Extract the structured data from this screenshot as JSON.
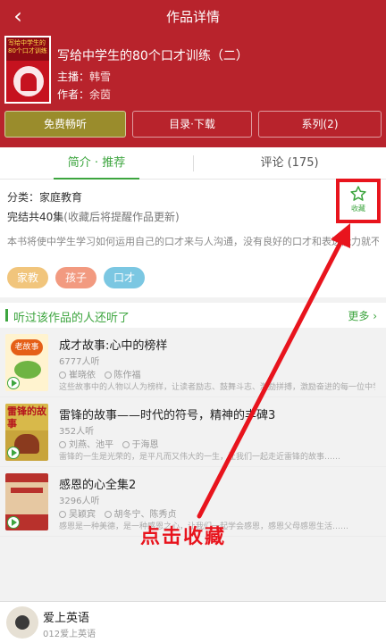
{
  "header": {
    "title": "作品详情",
    "back_icon": "‹",
    "book_title": "写给中学生的80个口才训练（二）",
    "host_label": "主播：",
    "host_value": "韩雪",
    "author_label": "作者：",
    "author_value": "余茵",
    "cover_text": "写给中学生的80个口才训练",
    "buttons": {
      "free_listen": "免费畅听",
      "catalog_download": "目录·下载",
      "series": "系列(2)"
    }
  },
  "tabs": {
    "intro": "简介 · 推荐",
    "comments": "评论 (175)"
  },
  "intro": {
    "category_label": "分类：",
    "category_value": "家庭教育",
    "episodes": "完结共40集",
    "episodes_note": "(收藏后将提醒作品更新)",
    "description": "本书将使中学生学习如何运用自己的口才来与人沟通，没有良好的口才和表达能力就不能将自己的优势展现。好口才的秘密就在书里！学习交友必不可少的指导伙伴",
    "tags": [
      "家教",
      "孩子",
      "口才"
    ],
    "favorite_label": "收藏"
  },
  "related": {
    "title": "听过该作品的人还听了",
    "more": "更多 ›",
    "items": [
      {
        "name": "成才故事:心中的榜样",
        "listeners": "6777人听",
        "people1": "崔晓依",
        "people2": "陈作福",
        "desc": "这些故事中的人物以人为榜样，让读者励志、鼓舞斗志、激励拼搏，激励奋进的每一位中学生不断努力奋斗……",
        "thumb_badge": "老故事"
      },
      {
        "name": "雷锋的故事——时代的符号，精神的丰碑3",
        "listeners": "352人听",
        "people1": "刘燕、池平",
        "people2": "于海恩",
        "desc": "雷锋的一生是光荣的，是平凡而又伟大的一生，让我们一起走近雷锋的故事……",
        "thumb_badge": "雷锋的故事"
      },
      {
        "name": "感恩的心全集2",
        "listeners": "3296人听",
        "people1": "吴颖宾",
        "people2": "胡冬宁、陈秀贞",
        "desc": "感恩是一种美德，是一种感恩之心，让我们一起学会感恩，感恩父母感恩生活……",
        "thumb_badge": ""
      }
    ]
  },
  "annotation": {
    "text": "点击收藏",
    "color": "#e8141d"
  },
  "player": {
    "title": "爱上英语",
    "subtitle": "012爱上英语"
  },
  "colors": {
    "header_red": "#b8232c",
    "accent_green": "#3da53f"
  }
}
